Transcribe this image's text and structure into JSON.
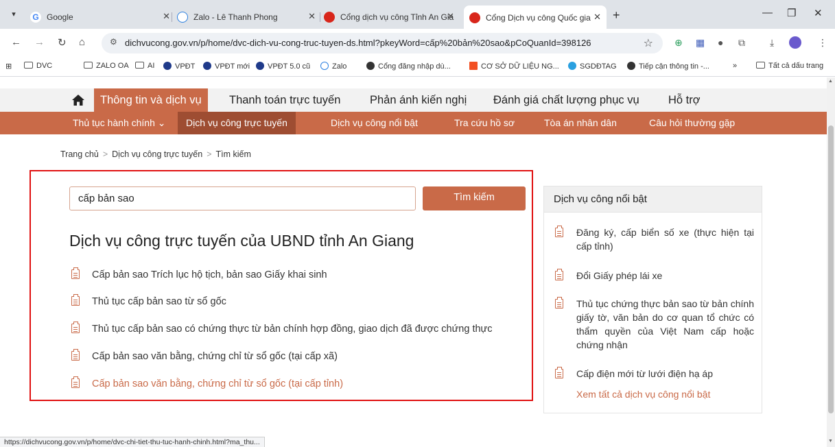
{
  "browser": {
    "tabs": [
      {
        "title": "Google",
        "active": false
      },
      {
        "title": "Zalo - Lê Thanh Phong",
        "active": false
      },
      {
        "title": "Cổng dịch vụ công Tỉnh An Gia",
        "active": false
      },
      {
        "title": "Cổng Dịch vụ công Quốc gia",
        "active": true
      }
    ],
    "url": "dichvucong.gov.vn/p/home/dvc-dich-vu-cong-truc-tuyen-ds.html?pkeyWord=cấp%20bản%20sao&pCoQuanId=398126",
    "bookmarks": [
      "DVC",
      "ZALO OA",
      "AI",
      "VPĐT",
      "VPĐT mới",
      "VPĐT 5.0 cũ",
      "Zalo",
      "Cổng đăng nhập dù...",
      "CƠ SỞ DỮ LIỆU NG...",
      "SGDĐTAG",
      "Tiếp cận thông tin -..."
    ],
    "bookmarks_more": "»",
    "all_bookmarks": "Tất cả dấu trang",
    "status_url": "https://dichvucong.gov.vn/p/home/dvc-chi-tiet-thu-tuc-hanh-chinh.html?ma_thu..."
  },
  "topnav": {
    "items": [
      "Thông tin và dịch vụ",
      "Thanh toán trực tuyến",
      "Phản ánh kiến nghị",
      "Đánh giá chất lượng phục vụ",
      "Hỗ trợ"
    ]
  },
  "subnav": {
    "items": [
      "Thủ tục hành chính ⌄",
      "Dịch vụ công trực tuyến",
      "Dịch vụ công nổi bật",
      "Tra cứu hồ sơ",
      "Tòa án nhân dân",
      "Câu hỏi thường gặp"
    ]
  },
  "breadcrumb": [
    "Trang chủ",
    "Dịch vụ công trực tuyến",
    "Tìm kiếm"
  ],
  "breadcrumb_sep": ">",
  "search": {
    "value": "cấp bản sao",
    "button": "Tìm kiếm"
  },
  "results": {
    "title": "Dịch vụ công trực tuyến của UBND tỉnh An Giang",
    "items": [
      "Cấp bản sao Trích lục hộ tịch, bản sao Giấy khai sinh",
      "Thủ tục cấp bản sao từ sổ gốc",
      "Thủ tục cấp bản sao có chứng thực từ bản chính hợp đồng, giao dịch đã được chứng thực",
      "Cấp bản sao văn bằng, chứng chỉ từ sổ gốc (tại cấp xã)",
      "Cấp bản sao văn bằng, chứng chỉ từ sổ gốc (tại cấp tỉnh)"
    ]
  },
  "sidebar": {
    "title": "Dịch vụ công nổi bật",
    "items": [
      "Đăng ký, cấp biển số xe (thực hiện tại cấp tỉnh)",
      "Đổi Giấy phép lái xe",
      "Thủ tục chứng thực bản sao từ bản chính giấy tờ, văn bản do cơ quan tổ chức có thẩm quyền của Việt Nam cấp hoặc chứng nhận",
      "Cấp điện mới từ lưới điện hạ áp"
    ],
    "more": "Xem tất cả dịch vụ công nổi bật"
  },
  "colors": {
    "accent": "#c96a48",
    "accent_dark": "#9e4d32",
    "highlight_box": "#e01010"
  }
}
